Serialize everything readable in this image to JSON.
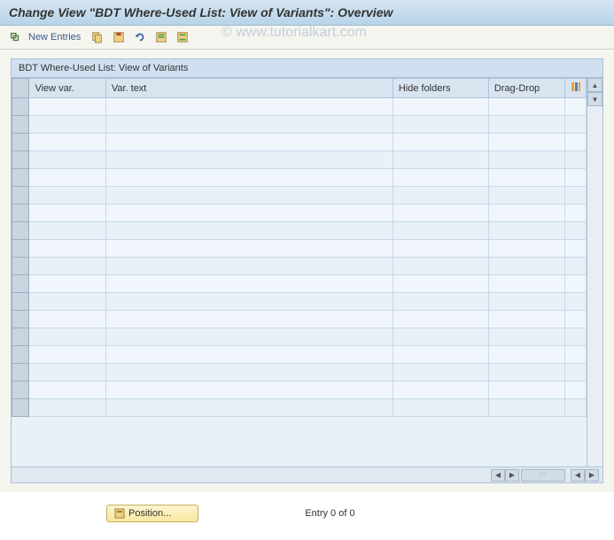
{
  "header": {
    "title": "Change View \"BDT Where-Used List: View of Variants\": Overview"
  },
  "toolbar": {
    "new_entries_label": "New Entries"
  },
  "watermark": "© www.tutorialkart.com",
  "panel": {
    "title": "BDT Where-Used List: View of Variants"
  },
  "table": {
    "columns": {
      "view_var": "View var.",
      "var_text": "Var. text",
      "hide_folders": "Hide folders",
      "drag_drop": "Drag-Drop"
    },
    "rows": [
      {
        "view_var": "",
        "var_text": "",
        "hide_folders": "",
        "drag_drop": ""
      },
      {
        "view_var": "",
        "var_text": "",
        "hide_folders": "",
        "drag_drop": ""
      },
      {
        "view_var": "",
        "var_text": "",
        "hide_folders": "",
        "drag_drop": ""
      },
      {
        "view_var": "",
        "var_text": "",
        "hide_folders": "",
        "drag_drop": ""
      },
      {
        "view_var": "",
        "var_text": "",
        "hide_folders": "",
        "drag_drop": ""
      },
      {
        "view_var": "",
        "var_text": "",
        "hide_folders": "",
        "drag_drop": ""
      },
      {
        "view_var": "",
        "var_text": "",
        "hide_folders": "",
        "drag_drop": ""
      },
      {
        "view_var": "",
        "var_text": "",
        "hide_folders": "",
        "drag_drop": ""
      },
      {
        "view_var": "",
        "var_text": "",
        "hide_folders": "",
        "drag_drop": ""
      },
      {
        "view_var": "",
        "var_text": "",
        "hide_folders": "",
        "drag_drop": ""
      },
      {
        "view_var": "",
        "var_text": "",
        "hide_folders": "",
        "drag_drop": ""
      },
      {
        "view_var": "",
        "var_text": "",
        "hide_folders": "",
        "drag_drop": ""
      },
      {
        "view_var": "",
        "var_text": "",
        "hide_folders": "",
        "drag_drop": ""
      },
      {
        "view_var": "",
        "var_text": "",
        "hide_folders": "",
        "drag_drop": ""
      },
      {
        "view_var": "",
        "var_text": "",
        "hide_folders": "",
        "drag_drop": ""
      },
      {
        "view_var": "",
        "var_text": "",
        "hide_folders": "",
        "drag_drop": ""
      },
      {
        "view_var": "",
        "var_text": "",
        "hide_folders": "",
        "drag_drop": ""
      },
      {
        "view_var": "",
        "var_text": "",
        "hide_folders": "",
        "drag_drop": ""
      }
    ]
  },
  "footer": {
    "position_label": "Position...",
    "entry_text": "Entry 0 of 0"
  }
}
